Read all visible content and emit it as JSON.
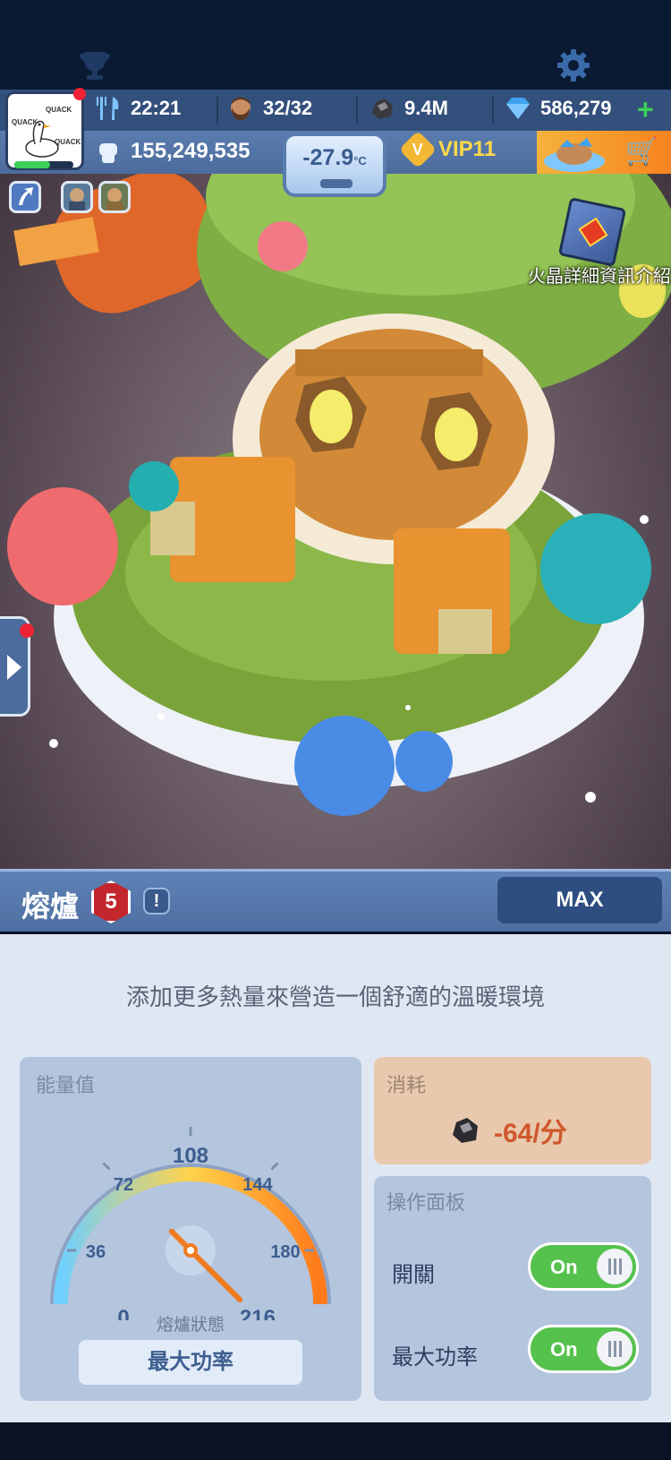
{
  "header": {
    "timer": "22:21",
    "population": "32/32",
    "coal": "9.4M",
    "gems": "586,279",
    "power": "155,249,535",
    "temperature": "-27.9",
    "temperature_unit": "°C",
    "vip": "VIP11",
    "vip_letter": "V"
  },
  "avatar": {
    "quack_1": "QUACK",
    "quack_2": "QUACK",
    "quack_3": "QUACK"
  },
  "map_shortcut": {
    "label": "火晶詳細資訊介紹"
  },
  "building": {
    "name": "熔爐",
    "level": "5",
    "info_symbol": "!",
    "max_label": "MAX"
  },
  "panel": {
    "description": "添加更多熱量來營造一個舒適的溫暖環境",
    "energy_title": "能量值",
    "gauge": {
      "ticks": [
        "0",
        "36",
        "72",
        "108",
        "144",
        "180",
        "216"
      ],
      "value": 216,
      "state_label": "熔爐狀態",
      "state_value": "最大功率"
    },
    "consume": {
      "title": "消耗",
      "value": "-64/分"
    },
    "ops": {
      "title": "操作面板",
      "switch_label": "開關",
      "switch_state": "On",
      "max_power_label": "最大功率",
      "max_power_state": "On"
    }
  },
  "colors": {
    "accent_orange": "#f7831f",
    "toggle_green": "#56c24e",
    "header_blue": "#4c6c9d"
  }
}
